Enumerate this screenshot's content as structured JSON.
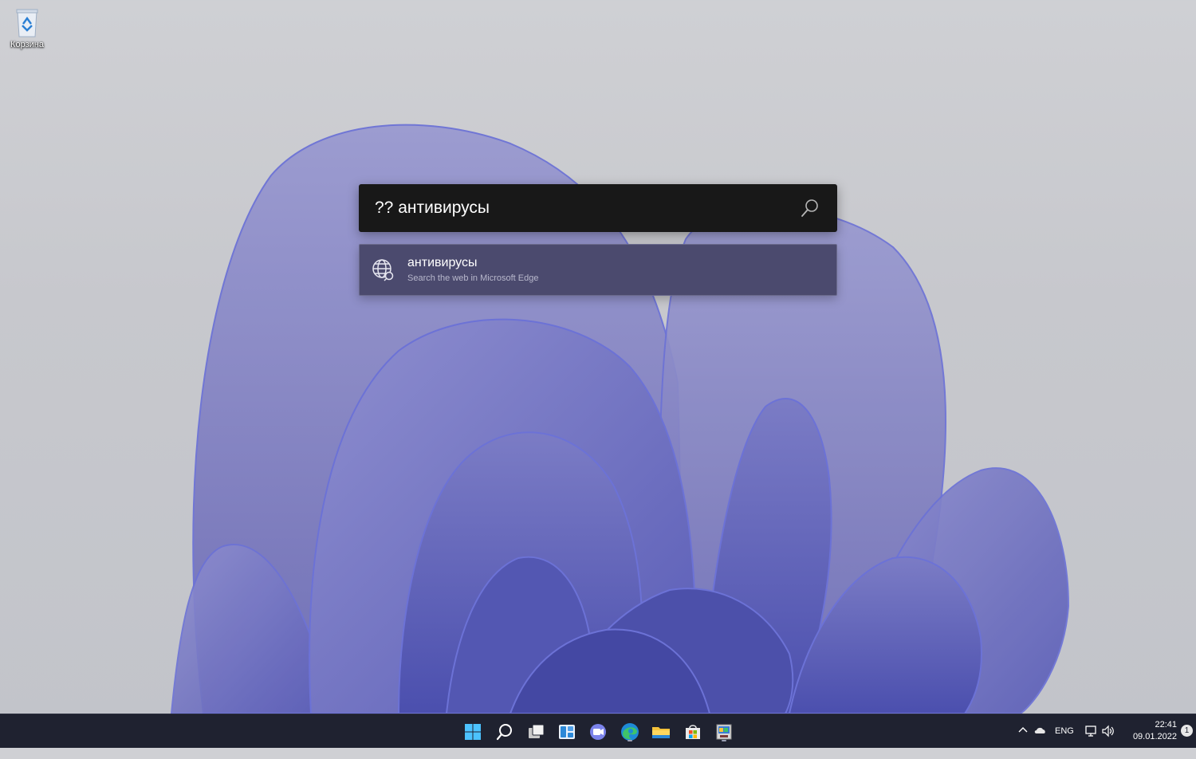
{
  "desktop": {
    "recycle_bin_label": "Корзина"
  },
  "search": {
    "query": "?? антивирусы",
    "search_icon": "search-icon"
  },
  "results": [
    {
      "title": "антивирусы",
      "subtitle": "Search the web in Microsoft Edge",
      "icon": "globe-search-icon"
    }
  ],
  "taskbar": {
    "apps": [
      "start-icon",
      "search-icon",
      "task-view-icon",
      "widgets-icon",
      "teams-chat-icon",
      "edge-icon",
      "file-explorer-icon",
      "store-icon",
      "app-icon"
    ],
    "tray": {
      "language": "ENG",
      "time": "22:41",
      "date": "09.01.2022",
      "notification_count": "1"
    }
  },
  "colors": {
    "search_bg": "#181818",
    "result_bg": "#4b4a6e",
    "taskbar_bg": "#1f2230",
    "accent_blue": "#4cc2ff"
  }
}
